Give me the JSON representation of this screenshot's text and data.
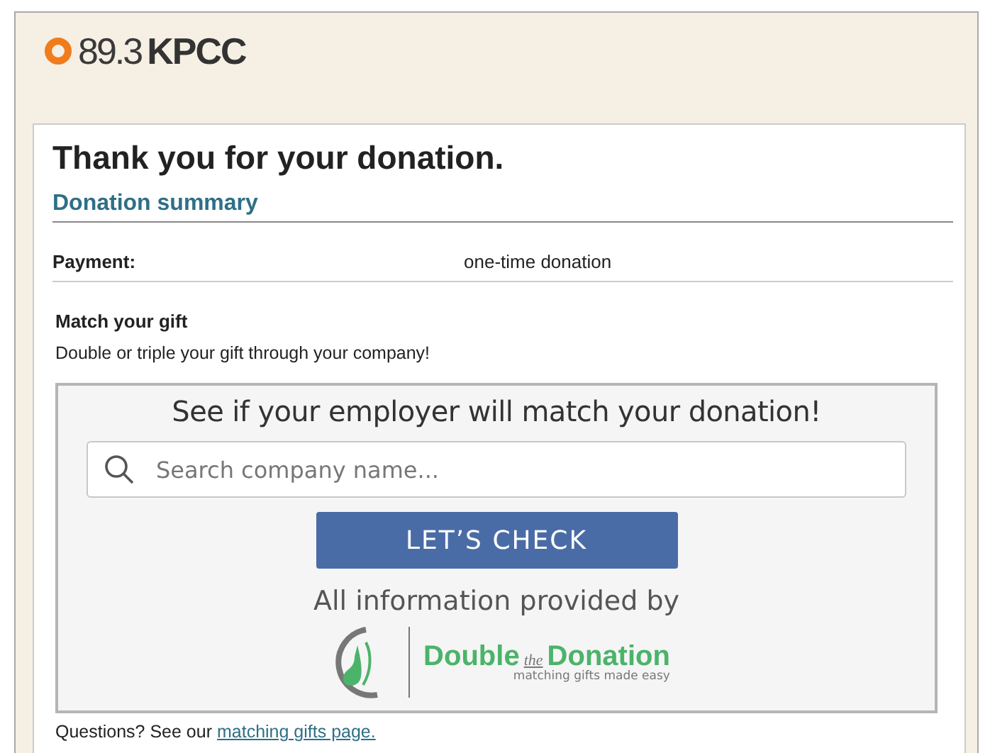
{
  "header": {
    "logo_frequency": "89.3",
    "logo_name": "KPCC"
  },
  "title": "Thank you for your donation.",
  "summary": {
    "heading": "Donation summary",
    "rows": [
      {
        "label": "Payment:",
        "value": "one-time donation"
      }
    ]
  },
  "match": {
    "heading": "Match your gift",
    "text": "Double or triple your gift through your company!"
  },
  "widget": {
    "heading": "See if your employer will match your donation!",
    "search": {
      "placeholder": "Search company name..."
    },
    "button": "LET’S CHECK",
    "provided_by": "All information provided by",
    "brand": {
      "first": "Double",
      "middle": "the",
      "last": "Donation",
      "tagline": "matching gifts made easy"
    }
  },
  "footer": {
    "text": "Questions? See our",
    "link": "matching gifts page."
  }
}
